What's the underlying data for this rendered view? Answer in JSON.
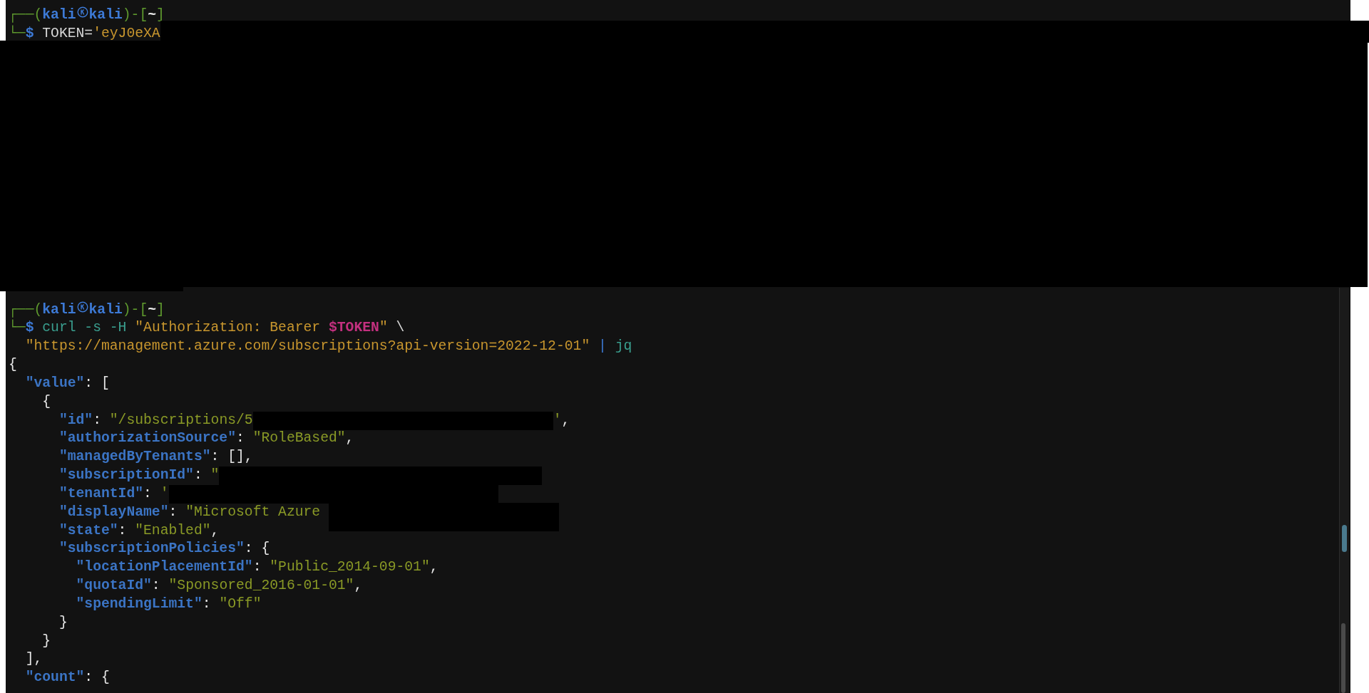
{
  "terminal": {
    "lines": [
      {
        "kind": "text",
        "segments": [
          {
            "kind": "frame",
            "text": "┌──("
          },
          {
            "kind": "user",
            "text": "kali"
          },
          {
            "kind": "icon"
          },
          {
            "kind": "user",
            "text": "kali"
          },
          {
            "kind": "frame",
            "text": ")-["
          },
          {
            "kind": "path",
            "text": "~"
          },
          {
            "kind": "frame",
            "text": "]"
          }
        ]
      },
      {
        "kind": "text",
        "segments": [
          {
            "kind": "frame",
            "text": "└─"
          },
          {
            "kind": "dollar",
            "text": "$"
          },
          {
            "kind": "plain",
            "text": " TOKEN="
          },
          {
            "kind": "string",
            "text": "'eyJ0eXA"
          },
          {
            "kind": "redacted"
          }
        ]
      },
      {
        "kind": "redaction"
      },
      {
        "kind": "text",
        "segments": [
          {
            "kind": "frame",
            "text": "┌──("
          },
          {
            "kind": "user",
            "text": "kali"
          },
          {
            "kind": "icon"
          },
          {
            "kind": "user",
            "text": "kali"
          },
          {
            "kind": "frame",
            "text": ")-["
          },
          {
            "kind": "path",
            "text": "~"
          },
          {
            "kind": "frame",
            "text": "]"
          }
        ]
      },
      {
        "kind": "text",
        "segments": [
          {
            "kind": "frame",
            "text": "└─"
          },
          {
            "kind": "dollar",
            "text": "$"
          },
          {
            "kind": "command",
            "text": " curl -s -H "
          },
          {
            "kind": "string",
            "text": "\"Authorization: Bearer "
          },
          {
            "kind": "variable",
            "text": "$TOKEN"
          },
          {
            "kind": "string",
            "text": "\""
          },
          {
            "kind": "plain",
            "text": " \\"
          }
        ]
      },
      {
        "kind": "text",
        "segments": [
          {
            "kind": "string",
            "text": "  \"https://management.azure.com/subscriptions?api-version=2022-12-01\""
          },
          {
            "kind": "pipe",
            "text": " |"
          },
          {
            "kind": "command",
            "text": " jq"
          }
        ]
      },
      {
        "kind": "text",
        "segments": [
          {
            "kind": "punct",
            "text": "{"
          }
        ]
      },
      {
        "kind": "text",
        "segments": [
          {
            "kind": "key",
            "text": "  \"value\""
          },
          {
            "kind": "punct",
            "text": ": ["
          }
        ]
      },
      {
        "kind": "text",
        "segments": [
          {
            "kind": "punct",
            "text": "    {"
          }
        ]
      },
      {
        "kind": "text",
        "segments": [
          {
            "kind": "key",
            "text": "      \"id\""
          },
          {
            "kind": "punct",
            "text": ": "
          },
          {
            "kind": "value",
            "text": "\"/subscriptions/5"
          },
          {
            "kind": "redacted"
          },
          {
            "kind": "value",
            "text": "'"
          },
          {
            "kind": "punct",
            "text": ","
          }
        ]
      },
      {
        "kind": "text",
        "segments": [
          {
            "kind": "key",
            "text": "      \"authorizationSource\""
          },
          {
            "kind": "punct",
            "text": ": "
          },
          {
            "kind": "value",
            "text": "\"RoleBased\""
          },
          {
            "kind": "punct",
            "text": ","
          }
        ]
      },
      {
        "kind": "text",
        "segments": [
          {
            "kind": "key",
            "text": "      \"managedByTenants\""
          },
          {
            "kind": "punct",
            "text": ": [],"
          }
        ]
      },
      {
        "kind": "text",
        "segments": [
          {
            "kind": "key",
            "text": "      \"subscriptionId\""
          },
          {
            "kind": "punct",
            "text": ": "
          },
          {
            "kind": "value",
            "text": "\""
          },
          {
            "kind": "redacted"
          }
        ]
      },
      {
        "kind": "text",
        "segments": [
          {
            "kind": "key",
            "text": "      \"tenantId\""
          },
          {
            "kind": "punct",
            "text": ": "
          },
          {
            "kind": "value",
            "text": "'"
          },
          {
            "kind": "redacted"
          }
        ]
      },
      {
        "kind": "text",
        "segments": [
          {
            "kind": "key",
            "text": "      \"displayName\""
          },
          {
            "kind": "punct",
            "text": ": "
          },
          {
            "kind": "value",
            "text": "\"Microsoft Azure "
          },
          {
            "kind": "redacted"
          }
        ]
      },
      {
        "kind": "text",
        "segments": [
          {
            "kind": "key",
            "text": "      \"state\""
          },
          {
            "kind": "punct",
            "text": ": "
          },
          {
            "kind": "value",
            "text": "\"Enabled\""
          },
          {
            "kind": "punct",
            "text": ","
          }
        ]
      },
      {
        "kind": "text",
        "segments": [
          {
            "kind": "key",
            "text": "      \"subscriptionPolicies\""
          },
          {
            "kind": "punct",
            "text": ": {"
          }
        ]
      },
      {
        "kind": "text",
        "segments": [
          {
            "kind": "key",
            "text": "        \"locationPlacementId\""
          },
          {
            "kind": "punct",
            "text": ": "
          },
          {
            "kind": "value",
            "text": "\"Public_2014-09-01\""
          },
          {
            "kind": "punct",
            "text": ","
          }
        ]
      },
      {
        "kind": "text",
        "segments": [
          {
            "kind": "key",
            "text": "        \"quotaId\""
          },
          {
            "kind": "punct",
            "text": ": "
          },
          {
            "kind": "value",
            "text": "\"Sponsored_2016-01-01\""
          },
          {
            "kind": "punct",
            "text": ","
          }
        ]
      },
      {
        "kind": "text",
        "segments": [
          {
            "kind": "key",
            "text": "        \"spendingLimit\""
          },
          {
            "kind": "punct",
            "text": ": "
          },
          {
            "kind": "value",
            "text": "\"Off\""
          }
        ]
      },
      {
        "kind": "text",
        "segments": [
          {
            "kind": "punct",
            "text": "      }"
          }
        ]
      },
      {
        "kind": "text",
        "segments": [
          {
            "kind": "punct",
            "text": "    }"
          }
        ]
      },
      {
        "kind": "text",
        "segments": [
          {
            "kind": "punct",
            "text": "  ],"
          }
        ]
      },
      {
        "kind": "text",
        "segments": [
          {
            "kind": "key",
            "text": "  \"count\""
          },
          {
            "kind": "punct",
            "text": ": {"
          }
        ]
      }
    ]
  }
}
